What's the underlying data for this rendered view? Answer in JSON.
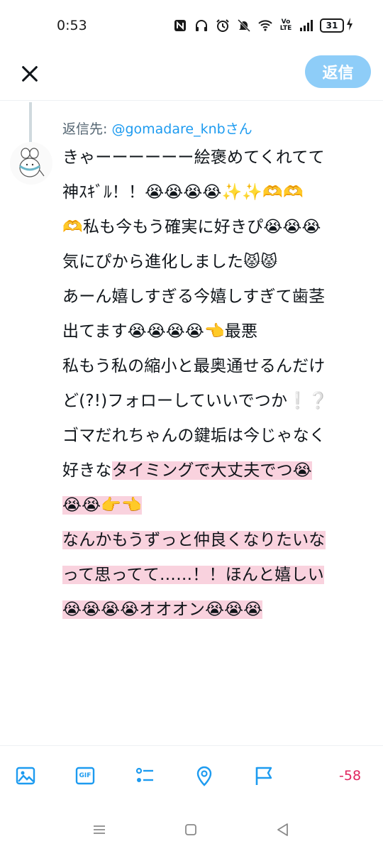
{
  "status_bar": {
    "time": "0:53",
    "network_label": "Vo LTE",
    "battery_level": "31",
    "icons": [
      "nfc-icon",
      "headphones-icon",
      "alarm-icon",
      "mute-icon",
      "wifi-icon",
      "volte-icon",
      "signal-icon",
      "battery-icon",
      "charging-icon"
    ]
  },
  "header": {
    "close_icon": "close-icon",
    "reply_button": "返信"
  },
  "compose": {
    "reply_to_prefix": "返信先: ",
    "reply_to_handle": "@gomadare_knbさん",
    "lines": [
      "きゃーーーーーー絵褒めてくれてて",
      "神ｽｷﾞﾙ！！😭😭😭😭✨✨🫶🫶",
      "🫶私も今もう確実に好きぴ😭😭😭",
      "気にぴから進化しました😾😾",
      "あーん嬉しすぎる今嬉しすぎて歯茎",
      "出てます😭😭😭😭👈最悪",
      "私もう私の縮小と最奥通せるんだけ",
      "ど(?!)フォローしていいでつか❕❔",
      "ゴマだれちゃんの鍵垢は今じゃなく",
      "好きなタイミングで大丈夫でつ😭",
      "😭😭👉👈",
      "なんかもうずっと仲良くなりたいな",
      "って思ってて……！！ほんと嬉しい",
      "😭😭😭😭オオオン😭😭😭"
    ],
    "line10_plain": "好きな",
    "line10_highlight": "タイミングで大丈夫でつ😭"
  },
  "toolbar": {
    "items": [
      "image-icon",
      "gif-icon",
      "poll-icon",
      "location-icon",
      "flag-icon"
    ],
    "gif_label": "GIF",
    "char_count": "-58"
  },
  "navigation": {
    "items": [
      "menu-icon",
      "home-icon",
      "back-icon"
    ]
  },
  "colors": {
    "accent": "#1d9bf0",
    "reply_button_bg": "#8ecdf8",
    "highlight": "#f9d2de",
    "over_limit": "#e0245e"
  }
}
